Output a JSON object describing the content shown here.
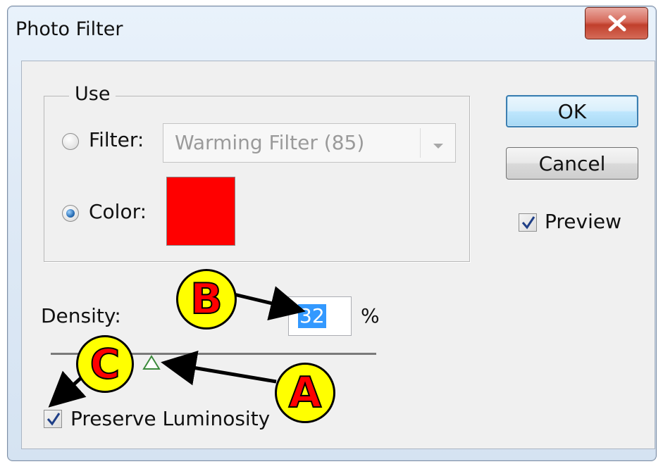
{
  "window": {
    "title": "Photo Filter",
    "close_label": "close"
  },
  "use_group": {
    "label": "Use",
    "filter_option": {
      "label": "Filter:",
      "selected": false,
      "dropdown_value": "Warming Filter (85)"
    },
    "color_option": {
      "label": "Color:",
      "selected": true,
      "swatch_color": "#ff0000"
    }
  },
  "buttons": {
    "ok_label": "OK",
    "cancel_label": "Cancel"
  },
  "preview": {
    "label": "Preview",
    "checked": true
  },
  "density": {
    "label": "Density:",
    "value": "32",
    "unit": "%",
    "slider_percent": 32
  },
  "preserve_luminosity": {
    "label": "Preserve Luminosity",
    "checked": true
  },
  "annotations": {
    "a": "A",
    "b": "B",
    "c": "C",
    "callout_fill": "#ffff00",
    "callout_text_color": "#ff0000"
  }
}
